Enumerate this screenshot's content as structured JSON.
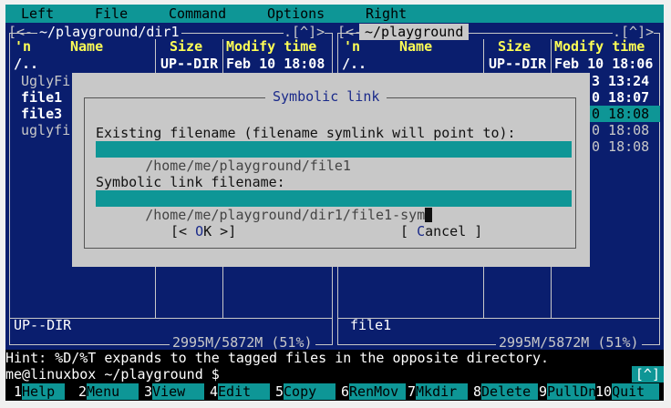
{
  "menu": [
    "Left",
    "File",
    "Command",
    "Options",
    "Right"
  ],
  "left_panel": {
    "path": "~/playground/dir1",
    "top_right": ".[^]>",
    "columns": {
      "n": "'n",
      "name": "Name",
      "size": "Size",
      "mtime": "Modify time"
    },
    "parent": {
      "name": "/..",
      "size": "UP--DIR",
      "mtime": "Feb 10 18:08"
    },
    "files": [
      "UglyFi",
      "file1",
      "file3",
      "uglyfi"
    ],
    "status": "UP--DIR",
    "disk": "2995M/5872M (51%)"
  },
  "right_panel": {
    "path": "~/playground",
    "top_right": ".[^]>",
    "columns": {
      "n": "'n",
      "name": "Name",
      "size": "Size",
      "mtime": "Modify time"
    },
    "parent": {
      "name": "/..",
      "size": "UP--DIR",
      "mtime": "Feb 10 18:06"
    },
    "visible_times": [
      "3 13:24",
      "0 18:07",
      "0 18:08",
      "0 18:08",
      "0 18:08"
    ],
    "status": "file1",
    "disk": "2995M/5872M (51%)"
  },
  "dialog": {
    "title": "Symbolic link",
    "existing_label": "Existing filename (filename symlink will point to):",
    "existing_value": "/home/me/playground/file1",
    "link_label": "Symbolic link filename:",
    "link_value": "/home/me/playground/dir1/file1-sym",
    "ok": {
      "pre": "[< ",
      "hot": "O",
      "post": "K >]"
    },
    "cancel": {
      "pre": "[ ",
      "hot": "C",
      "post": "ancel ]"
    }
  },
  "hint": "Hint: %D/%T expands to the tagged files in the opposite directory.",
  "command_line": {
    "prompt": "me@linuxbox ~/playground $",
    "button": "[^]"
  },
  "fkeys": [
    {
      "num": "1",
      "label": "Help"
    },
    {
      "num": "2",
      "label": "Menu"
    },
    {
      "num": "3",
      "label": "View"
    },
    {
      "num": "4",
      "label": "Edit"
    },
    {
      "num": "5",
      "label": "Copy"
    },
    {
      "num": "6",
      "label": "RenMov"
    },
    {
      "num": "7",
      "label": "Mkdir"
    },
    {
      "num": "8",
      "label": "Delete"
    },
    {
      "num": "9",
      "label": "PullDn"
    },
    {
      "num": "10",
      "label": "Quit"
    }
  ],
  "colors": {
    "bg": "#0a1e6e",
    "cyan": "#0e9696",
    "dialog": "#c8c8c8",
    "header": "#ffff55"
  }
}
